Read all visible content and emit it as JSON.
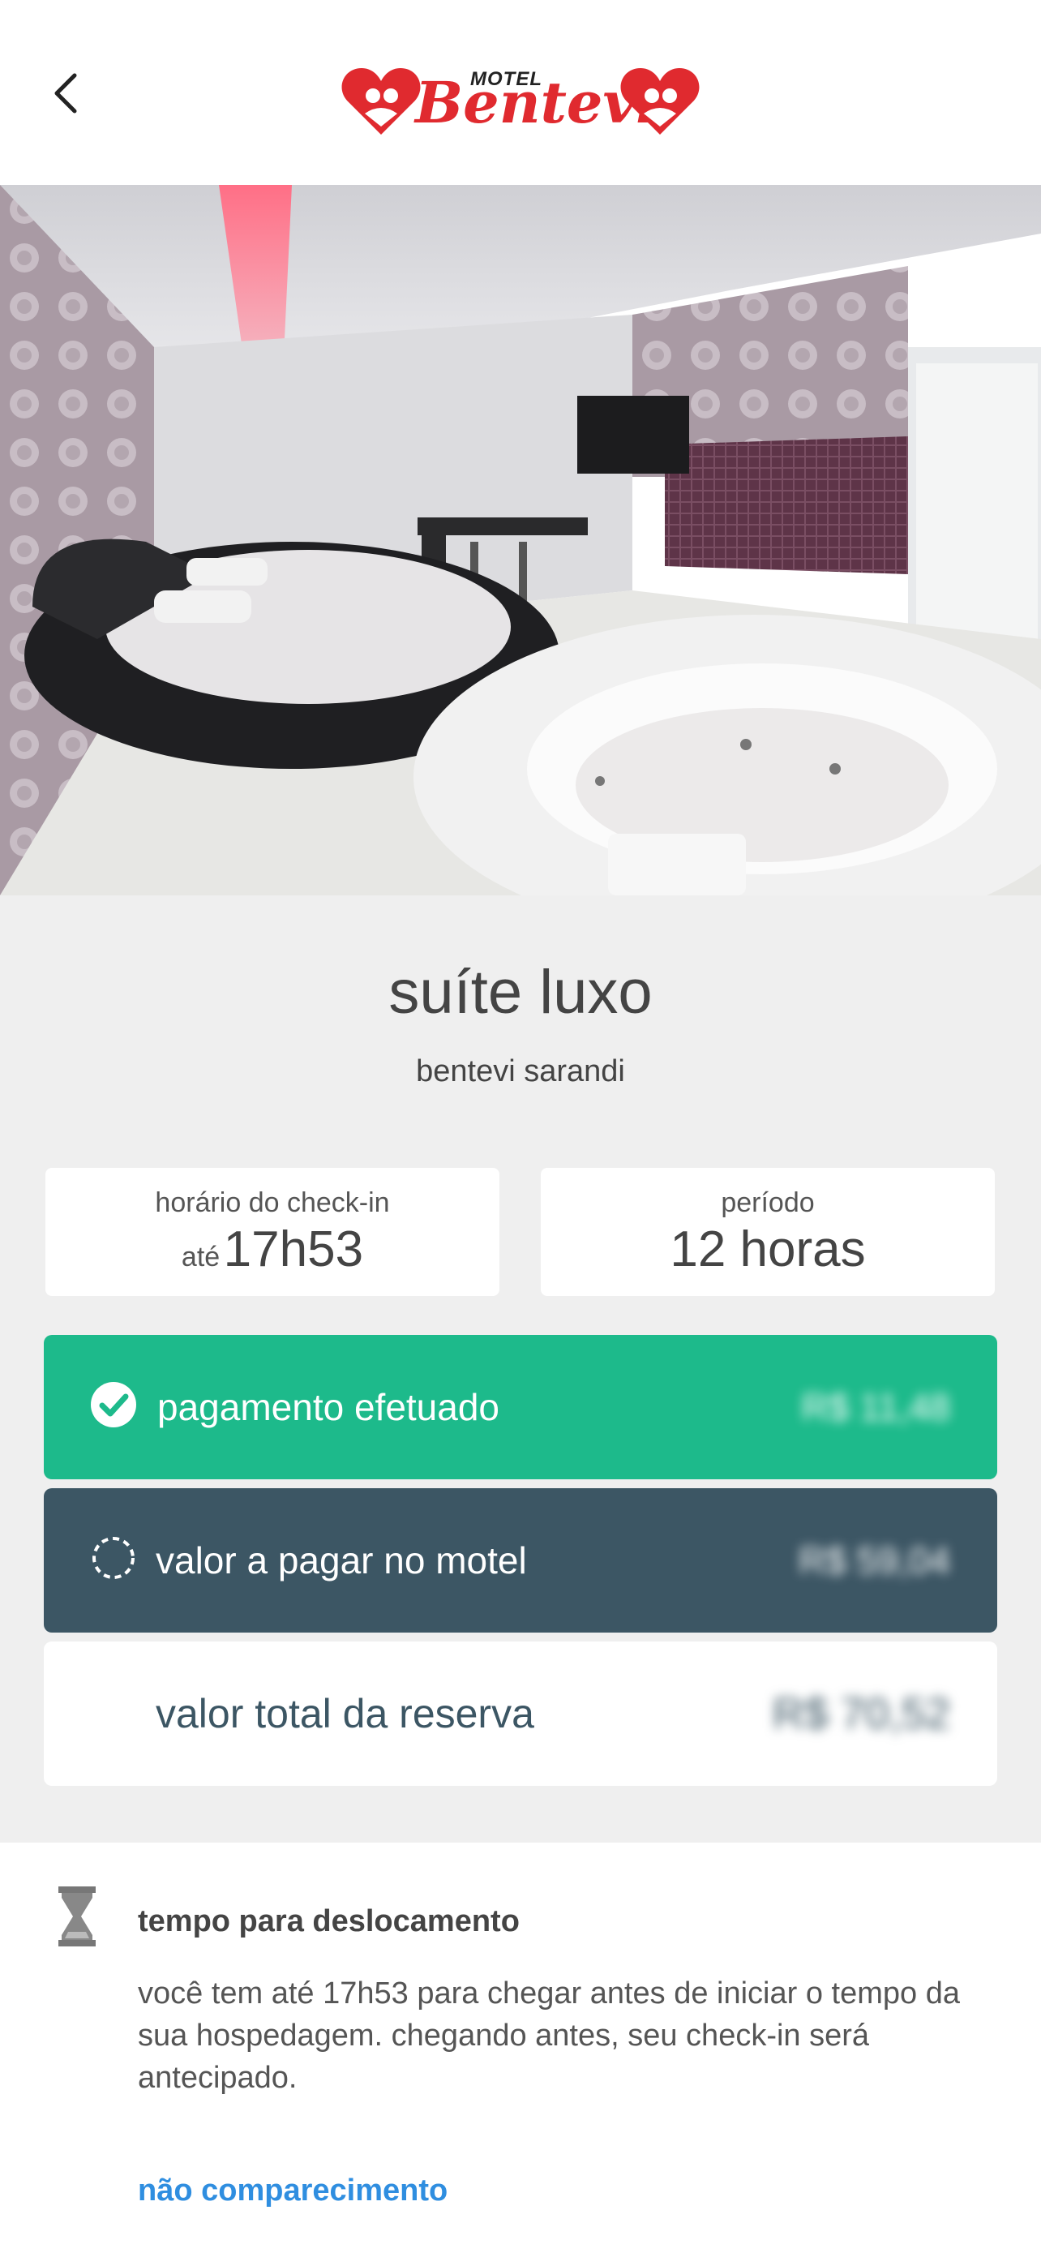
{
  "header": {
    "back_icon": "chevron-left-icon",
    "logo_top": "MOTEL",
    "logo_name": "Bentevi",
    "brand_color": "#e02a2f"
  },
  "suite": {
    "name": "suíte luxo",
    "location": "bentevi sarandi"
  },
  "checkin": {
    "label": "horário do check-in",
    "prefix": "até",
    "time": "17h53"
  },
  "period": {
    "label": "período",
    "value": "12 horas"
  },
  "payments": {
    "paid": {
      "label": "pagamento efetuado",
      "amount": "R$ 11,48",
      "icon": "check-circle-icon",
      "color": "#1dba8b"
    },
    "to_pay": {
      "label": "valor a pagar no motel",
      "amount": "R$ 59,04",
      "icon": "dashed-circle-icon",
      "color": "#3c5664"
    },
    "total": {
      "label": "valor total da reserva",
      "amount": "R$ 70,52"
    }
  },
  "travel": {
    "icon": "hourglass-icon",
    "title": "tempo para deslocamento",
    "description": "você tem até 17h53 para chegar antes de iniciar o tempo da sua hospedagem. chegando antes, seu check-in será antecipado."
  },
  "no_show": {
    "label": "não comparecimento",
    "color": "#2f8ee0"
  }
}
